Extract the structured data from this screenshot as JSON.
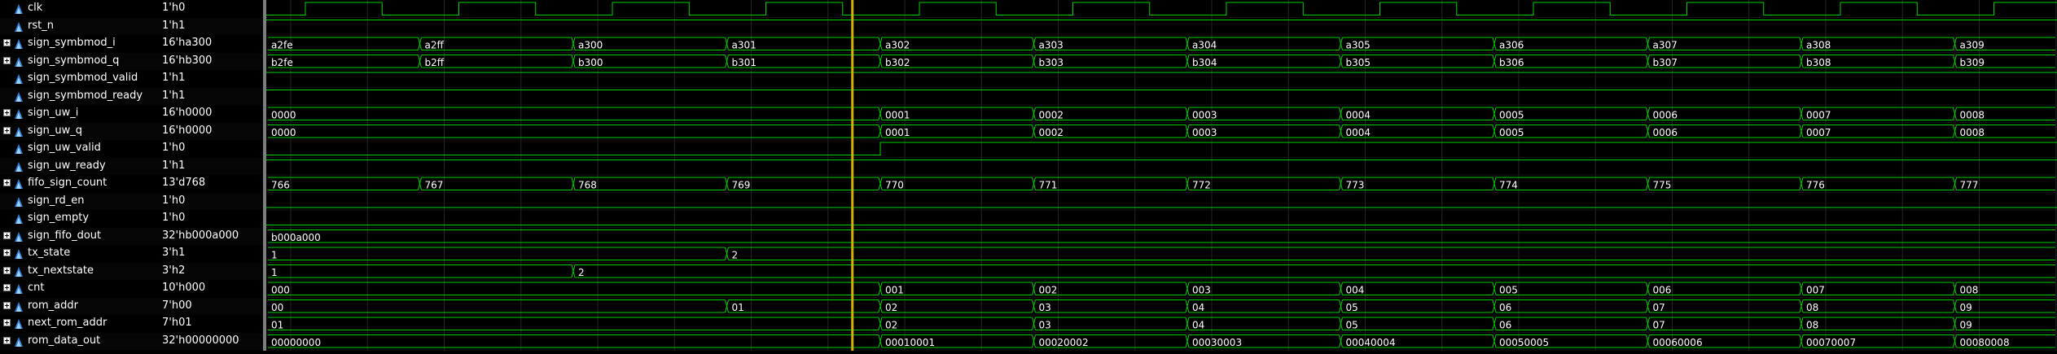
{
  "window": {
    "columns": [
      "signal_names",
      "cursor_values",
      "waveforms"
    ]
  },
  "colors": {
    "background": "#000000",
    "wave": "#00d000",
    "cursor": "#d4b000",
    "separator": "#7d7d7d",
    "text": "#ffffff",
    "signal_icon": "#2e7fd8"
  },
  "cursor": {
    "time_index": 4
  },
  "time_axis": {
    "transitions": 12
  },
  "signals": [
    {
      "name": "clk",
      "value": "1'h0",
      "type": "clock",
      "expandable": false
    },
    {
      "name": "rst_n",
      "value": "1'h1",
      "type": "bit",
      "expandable": false,
      "levels": [
        1
      ]
    },
    {
      "name": "sign_symbmod_i",
      "value": "16'ha300",
      "type": "bus",
      "expandable": true,
      "segments": [
        {
          "start": 0,
          "label": "a2fe"
        },
        {
          "start": 1,
          "label": "a2ff"
        },
        {
          "start": 2,
          "label": "a300"
        },
        {
          "start": 3,
          "label": "a301"
        },
        {
          "start": 4,
          "label": "a302"
        },
        {
          "start": 5,
          "label": "a303"
        },
        {
          "start": 6,
          "label": "a304"
        },
        {
          "start": 7,
          "label": "a305"
        },
        {
          "start": 8,
          "label": "a306"
        },
        {
          "start": 9,
          "label": "a307"
        },
        {
          "start": 10,
          "label": "a308"
        },
        {
          "start": 11,
          "label": "a309"
        }
      ]
    },
    {
      "name": "sign_symbmod_q",
      "value": "16'hb300",
      "type": "bus",
      "expandable": true,
      "segments": [
        {
          "start": 0,
          "label": "b2fe"
        },
        {
          "start": 1,
          "label": "b2ff"
        },
        {
          "start": 2,
          "label": "b300"
        },
        {
          "start": 3,
          "label": "b301"
        },
        {
          "start": 4,
          "label": "b302"
        },
        {
          "start": 5,
          "label": "b303"
        },
        {
          "start": 6,
          "label": "b304"
        },
        {
          "start": 7,
          "label": "b305"
        },
        {
          "start": 8,
          "label": "b306"
        },
        {
          "start": 9,
          "label": "b307"
        },
        {
          "start": 10,
          "label": "b308"
        },
        {
          "start": 11,
          "label": "b309"
        }
      ]
    },
    {
      "name": "sign_symbmod_valid",
      "value": "1'h1",
      "type": "bit",
      "expandable": false,
      "levels": [
        1
      ]
    },
    {
      "name": "sign_symbmod_ready",
      "value": "1'h1",
      "type": "bit",
      "expandable": false,
      "levels": [
        1
      ]
    },
    {
      "name": "sign_uw_i",
      "value": "16'h0000",
      "type": "bus",
      "expandable": true,
      "segments": [
        {
          "start": 0,
          "label": "0000"
        },
        {
          "start": 4,
          "label": "0001"
        },
        {
          "start": 5,
          "label": "0002"
        },
        {
          "start": 6,
          "label": "0003"
        },
        {
          "start": 7,
          "label": "0004"
        },
        {
          "start": 8,
          "label": "0005"
        },
        {
          "start": 9,
          "label": "0006"
        },
        {
          "start": 10,
          "label": "0007"
        },
        {
          "start": 11,
          "label": "0008"
        }
      ]
    },
    {
      "name": "sign_uw_q",
      "value": "16'h0000",
      "type": "bus",
      "expandable": true,
      "segments": [
        {
          "start": 0,
          "label": "0000"
        },
        {
          "start": 4,
          "label": "0001"
        },
        {
          "start": 5,
          "label": "0002"
        },
        {
          "start": 6,
          "label": "0003"
        },
        {
          "start": 7,
          "label": "0004"
        },
        {
          "start": 8,
          "label": "0005"
        },
        {
          "start": 9,
          "label": "0006"
        },
        {
          "start": 10,
          "label": "0007"
        },
        {
          "start": 11,
          "label": "0008"
        }
      ]
    },
    {
      "name": "sign_uw_valid",
      "value": "1'h0",
      "type": "bit",
      "expandable": false,
      "levels": [
        0,
        0,
        0,
        0,
        1
      ]
    },
    {
      "name": "sign_uw_ready",
      "value": "1'h1",
      "type": "bit",
      "expandable": false,
      "levels": [
        1
      ]
    },
    {
      "name": "fifo_sign_count",
      "value": "13'd768",
      "type": "bus",
      "expandable": true,
      "segments": [
        {
          "start": 0,
          "label": "766"
        },
        {
          "start": 1,
          "label": "767"
        },
        {
          "start": 2,
          "label": "768"
        },
        {
          "start": 3,
          "label": "769"
        },
        {
          "start": 4,
          "label": "770"
        },
        {
          "start": 5,
          "label": "771"
        },
        {
          "start": 6,
          "label": "772"
        },
        {
          "start": 7,
          "label": "773"
        },
        {
          "start": 8,
          "label": "774"
        },
        {
          "start": 9,
          "label": "775"
        },
        {
          "start": 10,
          "label": "776"
        },
        {
          "start": 11,
          "label": "777"
        }
      ]
    },
    {
      "name": "sign_rd_en",
      "value": "1'h0",
      "type": "bit",
      "expandable": false,
      "levels": [
        0
      ]
    },
    {
      "name": "sign_empty",
      "value": "1'h0",
      "type": "bit",
      "expandable": false,
      "levels": [
        0
      ]
    },
    {
      "name": "sign_fifo_dout",
      "value": "32'hb000a000",
      "type": "bus",
      "expandable": true,
      "segments": [
        {
          "start": 0,
          "label": "b000a000"
        }
      ]
    },
    {
      "name": "tx_state",
      "value": "3'h1",
      "type": "bus",
      "expandable": true,
      "segments": [
        {
          "start": 0,
          "label": "1"
        },
        {
          "start": 3,
          "label": "2"
        }
      ]
    },
    {
      "name": "tx_nextstate",
      "value": "3'h2",
      "type": "bus",
      "expandable": true,
      "segments": [
        {
          "start": 0,
          "label": "1"
        },
        {
          "start": 2,
          "label": "2"
        }
      ]
    },
    {
      "name": "cnt",
      "value": "10'h000",
      "type": "bus",
      "expandable": true,
      "segments": [
        {
          "start": 0,
          "label": "000"
        },
        {
          "start": 4,
          "label": "001"
        },
        {
          "start": 5,
          "label": "002"
        },
        {
          "start": 6,
          "label": "003"
        },
        {
          "start": 7,
          "label": "004"
        },
        {
          "start": 8,
          "label": "005"
        },
        {
          "start": 9,
          "label": "006"
        },
        {
          "start": 10,
          "label": "007"
        },
        {
          "start": 11,
          "label": "008"
        }
      ]
    },
    {
      "name": "rom_addr",
      "value": "7'h00",
      "type": "bus",
      "expandable": true,
      "segments": [
        {
          "start": 0,
          "label": "00"
        },
        {
          "start": 3,
          "label": "01"
        },
        {
          "start": 4,
          "label": "02"
        },
        {
          "start": 5,
          "label": "03"
        },
        {
          "start": 6,
          "label": "04"
        },
        {
          "start": 7,
          "label": "05"
        },
        {
          "start": 8,
          "label": "06"
        },
        {
          "start": 9,
          "label": "07"
        },
        {
          "start": 10,
          "label": "08"
        },
        {
          "start": 11,
          "label": "09"
        }
      ]
    },
    {
      "name": "next_rom_addr",
      "value": "7'h01",
      "type": "bus",
      "expandable": true,
      "segments": [
        {
          "start": 0,
          "label": "01"
        },
        {
          "start": 4,
          "label": "02"
        },
        {
          "start": 5,
          "label": "03"
        },
        {
          "start": 6,
          "label": "04"
        },
        {
          "start": 7,
          "label": "05"
        },
        {
          "start": 8,
          "label": "06"
        },
        {
          "start": 9,
          "label": "07"
        },
        {
          "start": 10,
          "label": "08"
        },
        {
          "start": 11,
          "label": "09"
        }
      ]
    },
    {
      "name": "rom_data_out",
      "value": "32'h00000000",
      "type": "bus",
      "expandable": true,
      "segments": [
        {
          "start": 0,
          "label": "00000000"
        },
        {
          "start": 4,
          "label": "00010001"
        },
        {
          "start": 5,
          "label": "00020002"
        },
        {
          "start": 6,
          "label": "00030003"
        },
        {
          "start": 7,
          "label": "00040004"
        },
        {
          "start": 8,
          "label": "00050005"
        },
        {
          "start": 9,
          "label": "00060006"
        },
        {
          "start": 10,
          "label": "00070007"
        },
        {
          "start": 11,
          "label": "00080008"
        }
      ]
    }
  ]
}
